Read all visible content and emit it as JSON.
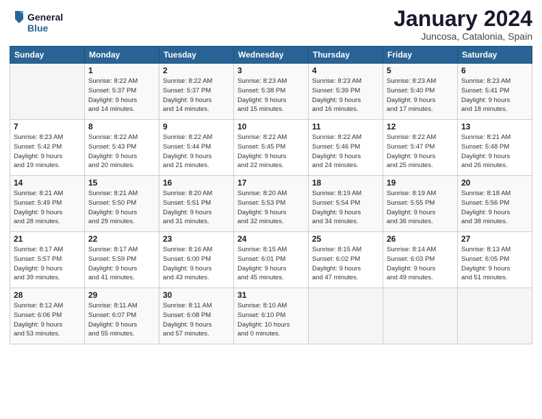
{
  "logo": {
    "text_general": "General",
    "text_blue": "Blue"
  },
  "title": "January 2024",
  "subtitle": "Juncosa, Catalonia, Spain",
  "headers": [
    "Sunday",
    "Monday",
    "Tuesday",
    "Wednesday",
    "Thursday",
    "Friday",
    "Saturday"
  ],
  "weeks": [
    [
      {
        "day": "",
        "info": ""
      },
      {
        "day": "1",
        "info": "Sunrise: 8:22 AM\nSunset: 5:37 PM\nDaylight: 9 hours\nand 14 minutes."
      },
      {
        "day": "2",
        "info": "Sunrise: 8:22 AM\nSunset: 5:37 PM\nDaylight: 9 hours\nand 14 minutes."
      },
      {
        "day": "3",
        "info": "Sunrise: 8:23 AM\nSunset: 5:38 PM\nDaylight: 9 hours\nand 15 minutes."
      },
      {
        "day": "4",
        "info": "Sunrise: 8:23 AM\nSunset: 5:39 PM\nDaylight: 9 hours\nand 16 minutes."
      },
      {
        "day": "5",
        "info": "Sunrise: 8:23 AM\nSunset: 5:40 PM\nDaylight: 9 hours\nand 17 minutes."
      },
      {
        "day": "6",
        "info": "Sunrise: 8:23 AM\nSunset: 5:41 PM\nDaylight: 9 hours\nand 18 minutes."
      }
    ],
    [
      {
        "day": "7",
        "info": "Sunrise: 8:23 AM\nSunset: 5:42 PM\nDaylight: 9 hours\nand 19 minutes."
      },
      {
        "day": "8",
        "info": "Sunrise: 8:22 AM\nSunset: 5:43 PM\nDaylight: 9 hours\nand 20 minutes."
      },
      {
        "day": "9",
        "info": "Sunrise: 8:22 AM\nSunset: 5:44 PM\nDaylight: 9 hours\nand 21 minutes."
      },
      {
        "day": "10",
        "info": "Sunrise: 8:22 AM\nSunset: 5:45 PM\nDaylight: 9 hours\nand 22 minutes."
      },
      {
        "day": "11",
        "info": "Sunrise: 8:22 AM\nSunset: 5:46 PM\nDaylight: 9 hours\nand 24 minutes."
      },
      {
        "day": "12",
        "info": "Sunrise: 8:22 AM\nSunset: 5:47 PM\nDaylight: 9 hours\nand 25 minutes."
      },
      {
        "day": "13",
        "info": "Sunrise: 8:21 AM\nSunset: 5:48 PM\nDaylight: 9 hours\nand 26 minutes."
      }
    ],
    [
      {
        "day": "14",
        "info": "Sunrise: 8:21 AM\nSunset: 5:49 PM\nDaylight: 9 hours\nand 28 minutes."
      },
      {
        "day": "15",
        "info": "Sunrise: 8:21 AM\nSunset: 5:50 PM\nDaylight: 9 hours\nand 29 minutes."
      },
      {
        "day": "16",
        "info": "Sunrise: 8:20 AM\nSunset: 5:51 PM\nDaylight: 9 hours\nand 31 minutes."
      },
      {
        "day": "17",
        "info": "Sunrise: 8:20 AM\nSunset: 5:53 PM\nDaylight: 9 hours\nand 32 minutes."
      },
      {
        "day": "18",
        "info": "Sunrise: 8:19 AM\nSunset: 5:54 PM\nDaylight: 9 hours\nand 34 minutes."
      },
      {
        "day": "19",
        "info": "Sunrise: 8:19 AM\nSunset: 5:55 PM\nDaylight: 9 hours\nand 36 minutes."
      },
      {
        "day": "20",
        "info": "Sunrise: 8:18 AM\nSunset: 5:56 PM\nDaylight: 9 hours\nand 38 minutes."
      }
    ],
    [
      {
        "day": "21",
        "info": "Sunrise: 8:17 AM\nSunset: 5:57 PM\nDaylight: 9 hours\nand 39 minutes."
      },
      {
        "day": "22",
        "info": "Sunrise: 8:17 AM\nSunset: 5:59 PM\nDaylight: 9 hours\nand 41 minutes."
      },
      {
        "day": "23",
        "info": "Sunrise: 8:16 AM\nSunset: 6:00 PM\nDaylight: 9 hours\nand 43 minutes."
      },
      {
        "day": "24",
        "info": "Sunrise: 8:15 AM\nSunset: 6:01 PM\nDaylight: 9 hours\nand 45 minutes."
      },
      {
        "day": "25",
        "info": "Sunrise: 8:15 AM\nSunset: 6:02 PM\nDaylight: 9 hours\nand 47 minutes."
      },
      {
        "day": "26",
        "info": "Sunrise: 8:14 AM\nSunset: 6:03 PM\nDaylight: 9 hours\nand 49 minutes."
      },
      {
        "day": "27",
        "info": "Sunrise: 8:13 AM\nSunset: 6:05 PM\nDaylight: 9 hours\nand 51 minutes."
      }
    ],
    [
      {
        "day": "28",
        "info": "Sunrise: 8:12 AM\nSunset: 6:06 PM\nDaylight: 9 hours\nand 53 minutes."
      },
      {
        "day": "29",
        "info": "Sunrise: 8:11 AM\nSunset: 6:07 PM\nDaylight: 9 hours\nand 55 minutes."
      },
      {
        "day": "30",
        "info": "Sunrise: 8:11 AM\nSunset: 6:08 PM\nDaylight: 9 hours\nand 57 minutes."
      },
      {
        "day": "31",
        "info": "Sunrise: 8:10 AM\nSunset: 6:10 PM\nDaylight: 10 hours\nand 0 minutes."
      },
      {
        "day": "",
        "info": ""
      },
      {
        "day": "",
        "info": ""
      },
      {
        "day": "",
        "info": ""
      }
    ]
  ]
}
